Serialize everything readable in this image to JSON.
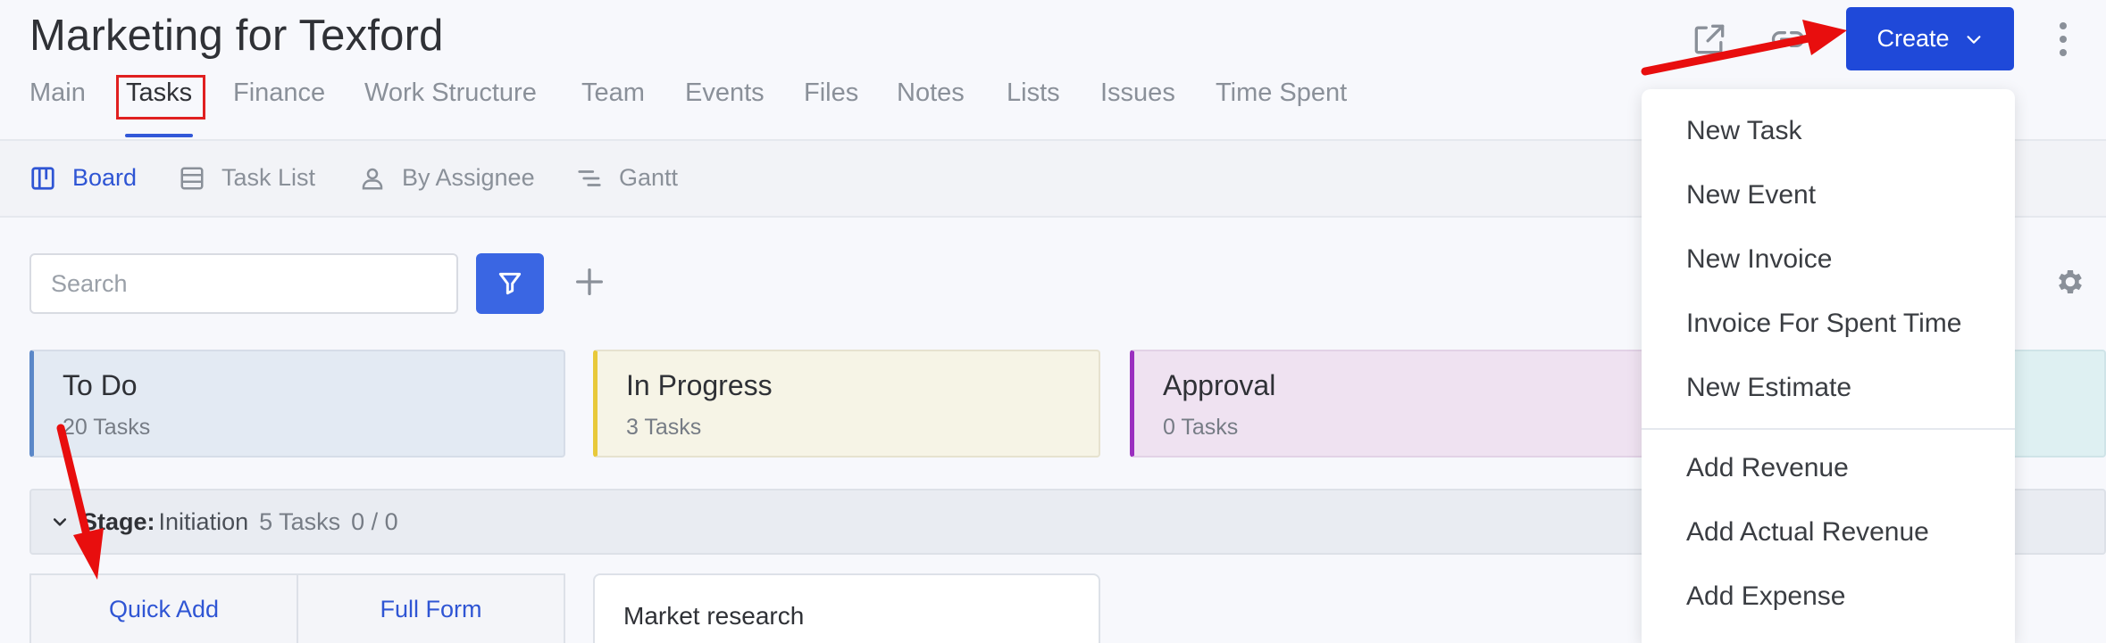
{
  "page": {
    "title": "Marketing for Texford"
  },
  "tabs": [
    {
      "label": "Main",
      "active": false
    },
    {
      "label": "Tasks",
      "active": true
    },
    {
      "label": "Finance",
      "active": false
    },
    {
      "label": "Work Structure",
      "active": false
    },
    {
      "label": "Team",
      "active": false
    },
    {
      "label": "Events",
      "active": false
    },
    {
      "label": "Files",
      "active": false
    },
    {
      "label": "Notes",
      "active": false
    },
    {
      "label": "Lists",
      "active": false
    },
    {
      "label": "Issues",
      "active": false
    },
    {
      "label": "Time Spent",
      "active": false
    }
  ],
  "header_actions": {
    "external_icon": "external-link-icon",
    "link_icon": "link-icon",
    "create_label": "Create",
    "create_icon": "chevron-down-icon",
    "more_icon": "kebab-menu-icon"
  },
  "views": [
    {
      "label": "Board",
      "icon": "board-icon",
      "active": true
    },
    {
      "label": "Task List",
      "icon": "list-icon",
      "active": false
    },
    {
      "label": "By Assignee",
      "icon": "user-icon",
      "active": false
    },
    {
      "label": "Gantt",
      "icon": "gantt-icon",
      "active": false
    }
  ],
  "toolbar": {
    "search_placeholder": "Search",
    "filter_icon": "filter-icon",
    "add_icon": "plus-icon",
    "settings_icon": "gear-icon"
  },
  "columns": [
    {
      "title": "To Do",
      "count": "20 Tasks",
      "color": "#5b88c8"
    },
    {
      "title": "In Progress",
      "count": "3 Tasks",
      "color": "#e8c93a"
    },
    {
      "title": "Approval",
      "count": "0 Tasks",
      "color": "#9a2fbf"
    }
  ],
  "stage": {
    "label": "Stage",
    "value": "Initiation",
    "count": "5 Tasks",
    "ratio": "0 / 0"
  },
  "quick_add": {
    "quick_label": "Quick Add",
    "full_label": "Full Form"
  },
  "card": {
    "title": "Market research"
  },
  "create_menu": {
    "items": [
      "New Task",
      "New Event",
      "New Invoice",
      "Invoice For Spent Time",
      "New Estimate",
      "Add Revenue",
      "Add Actual Revenue",
      "Add Expense"
    ]
  },
  "colors": {
    "accent": "#1f49d9",
    "annotation": "#e02020"
  }
}
